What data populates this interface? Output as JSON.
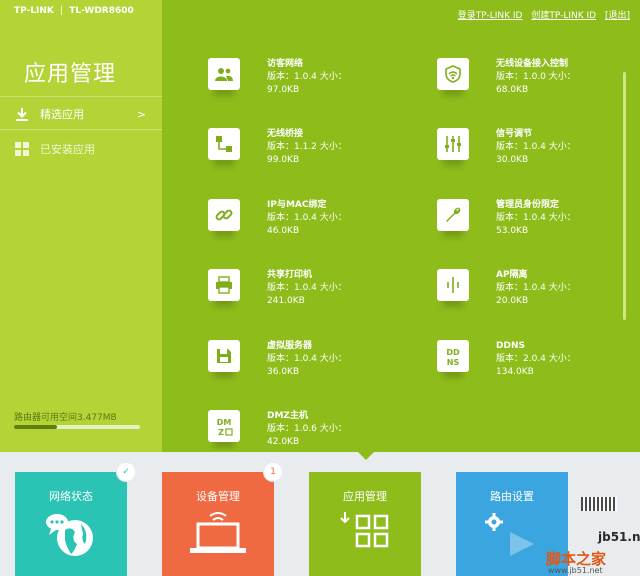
{
  "header": {
    "brand": "TP-LINK",
    "model": "TL-WDR8600",
    "links": [
      "登录TP-LINK ID",
      "创建TP-LINK ID",
      "[退出]"
    ]
  },
  "sidebar": {
    "title": "应用管理",
    "items": [
      {
        "label": "精选应用",
        "chevron": ">",
        "icon": "download-icon"
      },
      {
        "label": "已安装应用",
        "icon": "grid-icon"
      }
    ],
    "storage_label": "路由器可用空间3.477MB",
    "storage_fill": 0.34
  },
  "apps": [
    {
      "name": "访客网络",
      "version": "版本：1.0.4  大小：",
      "size": "97.0KB",
      "icon": "guest-users-icon"
    },
    {
      "name": "无线设备接入控制",
      "version": "版本：1.0.0  大小：",
      "size": "68.0KB",
      "icon": "wireless-shield-icon"
    },
    {
      "name": "无线桥接",
      "version": "版本：1.1.2  大小：",
      "size": "99.0KB",
      "icon": "bridge-icon"
    },
    {
      "name": "信号调节",
      "version": "版本：1.0.4  大小：",
      "size": "30.0KB",
      "icon": "signal-adjust-icon"
    },
    {
      "name": "IP与MAC绑定",
      "version": "版本：1.0.4  大小：",
      "size": "46.0KB",
      "icon": "link-icon"
    },
    {
      "name": "管理员身份限定",
      "version": "版本：1.0.4  大小：",
      "size": "53.0KB",
      "icon": "wrench-icon"
    },
    {
      "name": "共享打印机",
      "version": "版本：1.0.4  大小：",
      "size": "241.0KB",
      "icon": "printer-icon"
    },
    {
      "name": "AP隔离",
      "version": "版本：1.0.4  大小：",
      "size": "20.0KB",
      "icon": "ap-isolation-icon"
    },
    {
      "name": "虚拟服务器",
      "version": "版本：1.0.4  大小：",
      "size": "36.0KB",
      "icon": "server-icon"
    },
    {
      "name": "DDNS",
      "version": "版本：2.0.4  大小：",
      "size": "134.0KB",
      "icon": "ddns-icon"
    },
    {
      "name": "DMZ主机",
      "version": "版本：1.0.6  大小：",
      "size": "42.0KB",
      "icon": "dmz-icon"
    }
  ],
  "tiles": [
    {
      "label": "网络状态",
      "color": "#2bc3b4",
      "icon": "globe-icon",
      "badge": "✓"
    },
    {
      "label": "设备管理",
      "color": "#ef6a43",
      "icon": "laptop-icon",
      "badge": "1"
    },
    {
      "label": "应用管理",
      "color": "#8ebc1b",
      "icon": "apps-grid-icon"
    },
    {
      "label": "路由设置",
      "color": "#3aa5df",
      "icon": "gear-icon"
    }
  ],
  "watermark": {
    "site": "jb51.net",
    "name": "脚本之家",
    "url": "www.jb51.net"
  },
  "colors": {
    "sidebar": "#b4d336",
    "main": "#8ebc1b",
    "page": "#e9ecef"
  }
}
